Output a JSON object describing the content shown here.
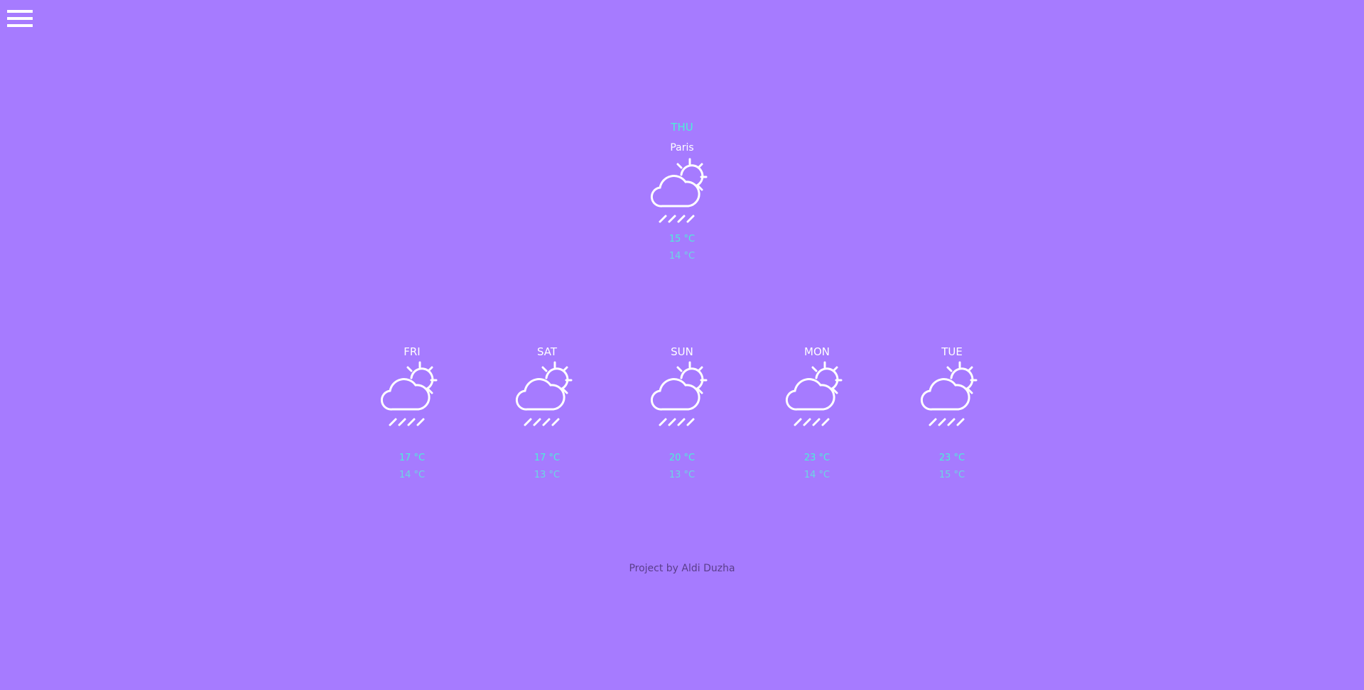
{
  "menu": {
    "icon": "hamburger-menu-icon"
  },
  "today": {
    "day": "THU",
    "city": "Paris",
    "icon": "partly-cloudy-rain-icon",
    "high": "15 °C",
    "low": "14 °C"
  },
  "forecast": [
    {
      "day": "FRI",
      "icon": "partly-cloudy-rain-icon",
      "high": "17 °C",
      "low": "14 °C"
    },
    {
      "day": "SAT",
      "icon": "partly-cloudy-rain-icon",
      "high": "17 °C",
      "low": "13 °C"
    },
    {
      "day": "SUN",
      "icon": "partly-cloudy-rain-icon",
      "high": "20 °C",
      "low": "13 °C"
    },
    {
      "day": "MON",
      "icon": "partly-cloudy-rain-icon",
      "high": "23 °C",
      "low": "14 °C"
    },
    {
      "day": "TUE",
      "icon": "partly-cloudy-rain-icon",
      "high": "23 °C",
      "low": "15 °C"
    }
  ],
  "footer": {
    "credit": "Project by Aldi Duzha"
  },
  "colors": {
    "background": "#a67bff",
    "accent": "#4af2d6",
    "accent_secondary": "#6ad8e2",
    "text_light": "#ffffff",
    "footer_text": "#5a3e8a"
  }
}
